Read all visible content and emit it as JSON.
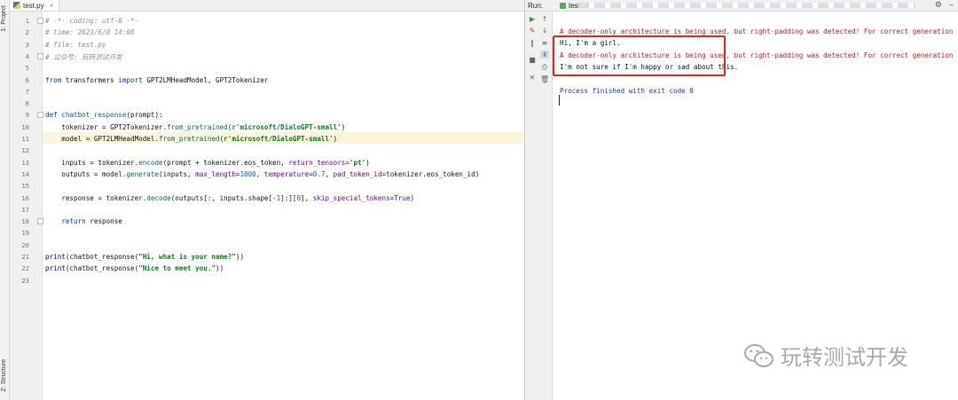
{
  "left_strip": {
    "project_label": "1: Project",
    "structure_label": "Z: Structure"
  },
  "editor": {
    "tab": {
      "filename": "test.py",
      "close": "×"
    },
    "current_line": 11,
    "lines": [
      {
        "num": "1",
        "tokens": [
          {
            "c": "com",
            "t": "# -*- coding: utf-8 -*-"
          }
        ]
      },
      {
        "num": "2",
        "tokens": [
          {
            "c": "com",
            "t": "# time: 2023/6/0 14:00"
          }
        ]
      },
      {
        "num": "3",
        "tokens": [
          {
            "c": "com",
            "t": "# file: test.py"
          }
        ]
      },
      {
        "num": "4",
        "tokens": [
          {
            "c": "com",
            "t": "# 公众号: 玩转测试开发"
          }
        ]
      },
      {
        "num": "5",
        "tokens": []
      },
      {
        "num": "6",
        "tokens": [
          {
            "c": "kw",
            "t": "from"
          },
          {
            "c": "",
            "t": " transformers "
          },
          {
            "c": "kw",
            "t": "import"
          },
          {
            "c": "",
            "t": " GPT2LMHeadModel, GPT2Tokenizer"
          }
        ]
      },
      {
        "num": "7",
        "tokens": []
      },
      {
        "num": "8",
        "tokens": []
      },
      {
        "num": "9",
        "tokens": [
          {
            "c": "kw",
            "t": "def"
          },
          {
            "c": "",
            "t": " "
          },
          {
            "c": "fn",
            "t": "chatbot_response"
          },
          {
            "c": "",
            "t": "(prompt):"
          }
        ]
      },
      {
        "num": "10",
        "tokens": [
          {
            "c": "",
            "t": "    tokenizer = GPT2Tokenizer."
          },
          {
            "c": "fn",
            "t": "from_pretrained"
          },
          {
            "c": "",
            "t": "("
          },
          {
            "c": "str",
            "t": "r'microsoft/DialoGPT-small'"
          },
          {
            "c": "",
            "t": ")"
          }
        ]
      },
      {
        "num": "11",
        "tokens": [
          {
            "c": "",
            "t": "    model = GPT2LMHeadModel."
          },
          {
            "c": "fn",
            "t": "from_pretrained"
          },
          {
            "c": "",
            "t": "("
          },
          {
            "c": "str",
            "t": "r'microsoft/DialoGPT-small'"
          },
          {
            "c": "",
            "t": ")"
          }
        ]
      },
      {
        "num": "12",
        "tokens": []
      },
      {
        "num": "13",
        "tokens": [
          {
            "c": "",
            "t": "    inputs = tokenizer."
          },
          {
            "c": "fn",
            "t": "encode"
          },
          {
            "c": "",
            "t": "(prompt + tokenizer.eos_token, "
          },
          {
            "c": "par",
            "t": "return_tensors"
          },
          {
            "c": "",
            "t": "="
          },
          {
            "c": "str",
            "t": "'pt'"
          },
          {
            "c": "",
            "t": ")"
          }
        ]
      },
      {
        "num": "14",
        "tokens": [
          {
            "c": "",
            "t": "    outputs = model."
          },
          {
            "c": "fn",
            "t": "generate"
          },
          {
            "c": "",
            "t": "(inputs, "
          },
          {
            "c": "par",
            "t": "max_length"
          },
          {
            "c": "",
            "t": "="
          },
          {
            "c": "num",
            "t": "1000"
          },
          {
            "c": "",
            "t": ", "
          },
          {
            "c": "par",
            "t": "temperature"
          },
          {
            "c": "",
            "t": "="
          },
          {
            "c": "num",
            "t": "0.7"
          },
          {
            "c": "",
            "t": ", "
          },
          {
            "c": "par",
            "t": "pad_token_id"
          },
          {
            "c": "",
            "t": "=tokenizer.eos_token_id)"
          }
        ]
      },
      {
        "num": "15",
        "tokens": []
      },
      {
        "num": "16",
        "tokens": [
          {
            "c": "",
            "t": "    response = tokenizer."
          },
          {
            "c": "fn",
            "t": "decode"
          },
          {
            "c": "",
            "t": "(outputs[:, inputs.shape[-"
          },
          {
            "c": "num",
            "t": "1"
          },
          {
            "c": "",
            "t": "]:]["
          },
          {
            "c": "num",
            "t": "0"
          },
          {
            "c": "",
            "t": "], "
          },
          {
            "c": "par",
            "t": "skip_special_tokens"
          },
          {
            "c": "",
            "t": "="
          },
          {
            "c": "kw",
            "t": "True"
          },
          {
            "c": "",
            "t": ")"
          }
        ]
      },
      {
        "num": "17",
        "tokens": []
      },
      {
        "num": "18",
        "tokens": [
          {
            "c": "",
            "t": "    "
          },
          {
            "c": "kw",
            "t": "return"
          },
          {
            "c": "",
            "t": " response"
          }
        ]
      },
      {
        "num": "19",
        "tokens": []
      },
      {
        "num": "20",
        "tokens": []
      },
      {
        "num": "21",
        "tokens": [
          {
            "c": "bi",
            "t": "print"
          },
          {
            "c": "",
            "t": "(chatbot_response("
          },
          {
            "c": "str",
            "t": "\"Hi, what is your name?\""
          },
          {
            "c": "",
            "t": "))"
          }
        ]
      },
      {
        "num": "22",
        "tokens": [
          {
            "c": "bi",
            "t": "print"
          },
          {
            "c": "",
            "t": "(chatbot_response("
          },
          {
            "c": "str",
            "t": "\"Nice to meet you.\""
          },
          {
            "c": "",
            "t": "))"
          }
        ]
      },
      {
        "num": "23",
        "tokens": []
      }
    ]
  },
  "run": {
    "label": "Run:",
    "tab_name": "test",
    "toolbar_icons": [
      "play-icon",
      "arrow-up-icon",
      "arrow-down-icon",
      "pause-icon",
      "wrap-icon",
      "scroll-end-icon",
      "stop-icon",
      "print-icon",
      "delete-icon",
      "pin-icon"
    ],
    "output": [
      {
        "kind": "err",
        "text": "A decoder-only architecture is being used, but right-padding was detected! For correct generation results"
      },
      {
        "kind": "out",
        "text": "Hi, I'm a girl."
      },
      {
        "kind": "err",
        "text": "A decoder-only architecture is being used, but right-padding was detected! For correct generation results"
      },
      {
        "kind": "out",
        "text": "I'm not sure if I'm happy or sad about this."
      },
      {
        "kind": "blank",
        "text": ""
      },
      {
        "kind": "exit",
        "text": "Process finished with exit code 0"
      }
    ]
  },
  "watermark": {
    "text": "玩转测试开发"
  },
  "colors": {
    "accent_highlight": "#e02323",
    "error_text": "#c41a16",
    "keyword": "#0033b3",
    "string": "#067d17"
  }
}
